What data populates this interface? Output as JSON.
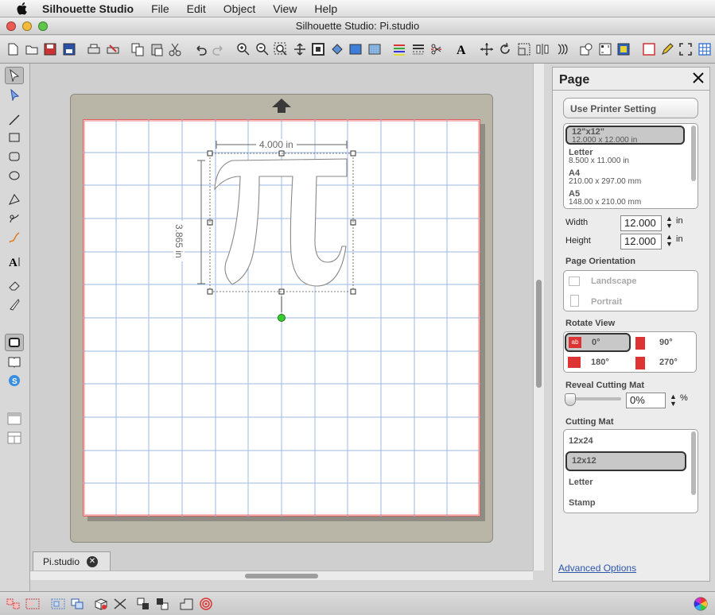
{
  "menubar": {
    "app": "Silhouette Studio",
    "items": [
      "File",
      "Edit",
      "Object",
      "View",
      "Help"
    ]
  },
  "window": {
    "title": "Silhouette Studio: Pi.studio"
  },
  "toolbar": {
    "icons": [
      "new-file-icon",
      "open-file-icon",
      "save-icon",
      "save-to-library-icon",
      "print-icon",
      "print-cut-icon",
      "copy-icon",
      "paste-icon",
      "cut-icon",
      "undo-icon",
      "redo-icon",
      "zoom-in-icon",
      "zoom-out-icon",
      "zoom-selection-icon",
      "pan-icon",
      "fit-to-page-icon",
      "fill-bucket-icon",
      "fill-color-icon",
      "fill-pattern-icon",
      "line-color-icon",
      "line-style-icon",
      "cut-settings-icon",
      "text-style-icon",
      "transform-icon",
      "rotate-icon",
      "scale-icon",
      "align-icon",
      "replicate-icon",
      "offset-icon",
      "trace-icon",
      "page-settings-icon",
      "registration-marks-icon",
      "cut-border-icon",
      "sketch-pen-icon",
      "expand-icon",
      "grid-icon"
    ]
  },
  "tools": {
    "left": [
      "select-tool-icon",
      "edit-points-icon",
      "line-tool-icon",
      "rectangle-tool-icon",
      "rounded-rectangle-tool-icon",
      "ellipse-tool-icon",
      "polygon-tool-icon",
      "curve-tool-icon",
      "freehand-tool-icon",
      "text-tool-icon",
      "eraser-tool-icon",
      "knife-tool-icon",
      "design-page-icon",
      "library-icon",
      "online-store-icon",
      "panel-view-icon",
      "split-view-icon"
    ]
  },
  "canvas": {
    "width_label": "4.000 in",
    "height_label": "3.865 in",
    "glyph": "π"
  },
  "tab": {
    "label": "Pi.studio"
  },
  "panel": {
    "title": "Page",
    "use_printer_button": "Use Printer Setting",
    "sizes": [
      {
        "name": "12\"x12\"",
        "dims": "12.000 x 12.000 in"
      },
      {
        "name": "Letter",
        "dims": "8.500 x 11.000 in"
      },
      {
        "name": "A4",
        "dims": "210.00 x 297.00 mm"
      },
      {
        "name": "A5",
        "dims": "148.00 x 210.00 mm"
      }
    ],
    "width_label": "Width",
    "width_value": "12.000",
    "width_unit": "in",
    "height_label": "Height",
    "height_value": "12.000",
    "height_unit": "in",
    "orientation_label": "Page Orientation",
    "orientation_options": [
      "Landscape",
      "Portrait"
    ],
    "rotate_label": "Rotate View",
    "rotate_options": [
      "0°",
      "90°",
      "180°",
      "270°"
    ],
    "reveal_label": "Reveal Cutting Mat",
    "reveal_value": "0%",
    "reveal_unit": "%",
    "mat_label": "Cutting Mat",
    "mats": [
      "12x24",
      "12x12",
      "Letter",
      "Stamp"
    ],
    "advanced_link": "Advanced Options"
  },
  "bottom": {
    "icons": [
      "group-icon",
      "ungroup-icon",
      "make-compound-path-icon",
      "release-compound-path-icon",
      "select-all-icon",
      "deselect-icon",
      "bring-to-front-icon",
      "send-to-back-icon",
      "weld-icon",
      "offset-cut-icon",
      "color-wheel-icon"
    ]
  }
}
